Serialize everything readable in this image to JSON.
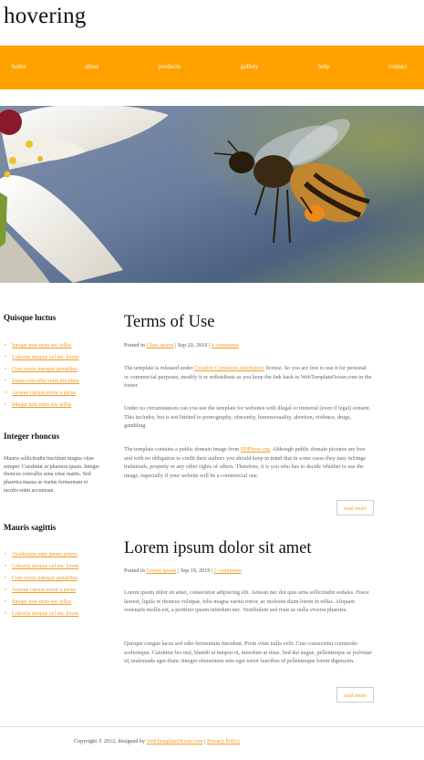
{
  "site": {
    "title": "hovering"
  },
  "nav": [
    "home",
    "about",
    "products",
    "gallery",
    "help",
    "contact"
  ],
  "sidebar": {
    "sections": [
      {
        "heading": "Quisque luctus",
        "links": [
          "Integer non enim nec tellus",
          "Lobortis tempus vel nec lorem",
          "Cum sociis natoque penatibus",
          "Etiam convallis enim tincidunt",
          "Aenean rutrum tortor a purus",
          "Integer non enim nec tellus"
        ]
      },
      {
        "heading": "Integer rhoncus",
        "text": "Mauris sollicitudin tincidunt magna vitae semper. Curabitur ut pharetra quam. Integer rhoncus convallis urna vitae mattis. Sed pharetra massa ac metus fermentum et iaculis enim accumsan."
      },
      {
        "heading": "Mauris sagittis",
        "links": [
          "Vestibulum ante ipsum primis",
          "Lobortis tempus vel nec lorem",
          "Cum sociis natoque penatibus",
          "Aenean rutrum tortor a purus",
          "Integer non enim nec tellus",
          "Lobortis tempus vel nec lorem"
        ]
      }
    ]
  },
  "posts": [
    {
      "title": "Terms of Use",
      "meta_prefix": "Posted in",
      "category": "Class aptent",
      "date": "Sep 20, 2019",
      "comments": "4 comments",
      "p1_pre": "The template is released under ",
      "p1_link": "Creative Commons Attribution",
      "p1_post": " license. So you are free to use it for personal or commercial purposes, modify it or redistribute as you keep the link back to WebTemplateOcean.com in the footer.",
      "p2": "Under no circumstances can you use the template for websites with illegal or immoral (even if legal) content. This includes, but is not limited to pornography, obscenity, homosexuality, abortion, violence, drugs, gambling.",
      "p3_pre": "The template contains a public domain image from ",
      "p3_link": "PDPhoto.org",
      "p3_post": ". Although public domain pictures are free and with no obligation to credit their authors you should keep in mind that in some cases they may infringe trademark, property or any other rights of others. Therefore, it is you who has to decide whether to use the image, especially if your website will be a commercial one.",
      "read_more": "read more"
    },
    {
      "title": "Lorem ipsum dolor sit amet",
      "meta_prefix": "Posted in",
      "category": "Lorem ipsum",
      "date": "Sep 19, 2019",
      "comments": "2 comments",
      "p1": "Lorem ipsum dolor sit amet, consectetur adipiscing elit. Aenean nec dui quis urna sollicitudin sodales. Fusce laoreet, ligula et rhoncus volutpat, felis magna varius tortor, ac molestie diam lorem in tellus. Aliquam venenatis mollis est, a porttitor ipsum interdum nec. Vestibulum sed risus ac nulla viverra pharetra.",
      "p2": "Quisque congue lacus sed odio fermentum tincidunt. Proin vitae nulla velit. Cras consectetur commodo scelerisque. Curabitur leo nisl, blandit at tempus et, interdum at risus. Sed dui augue, pellentesque ac pulvinar id, malesuada eget diam. Integer elementum sem eget tortor faucibus id pellentesque lorem dignissim.",
      "read_more": "read more"
    }
  ],
  "footer": {
    "prefix": "Copyright © 2012, designed by ",
    "link1": "WebTemplateOcean.com",
    "sep": " | ",
    "link2": "Privacy Policy"
  },
  "colors": {
    "accent": "#ffa200",
    "link": "#f29b25"
  },
  "hero_image": "bee-hovering-over-flower"
}
